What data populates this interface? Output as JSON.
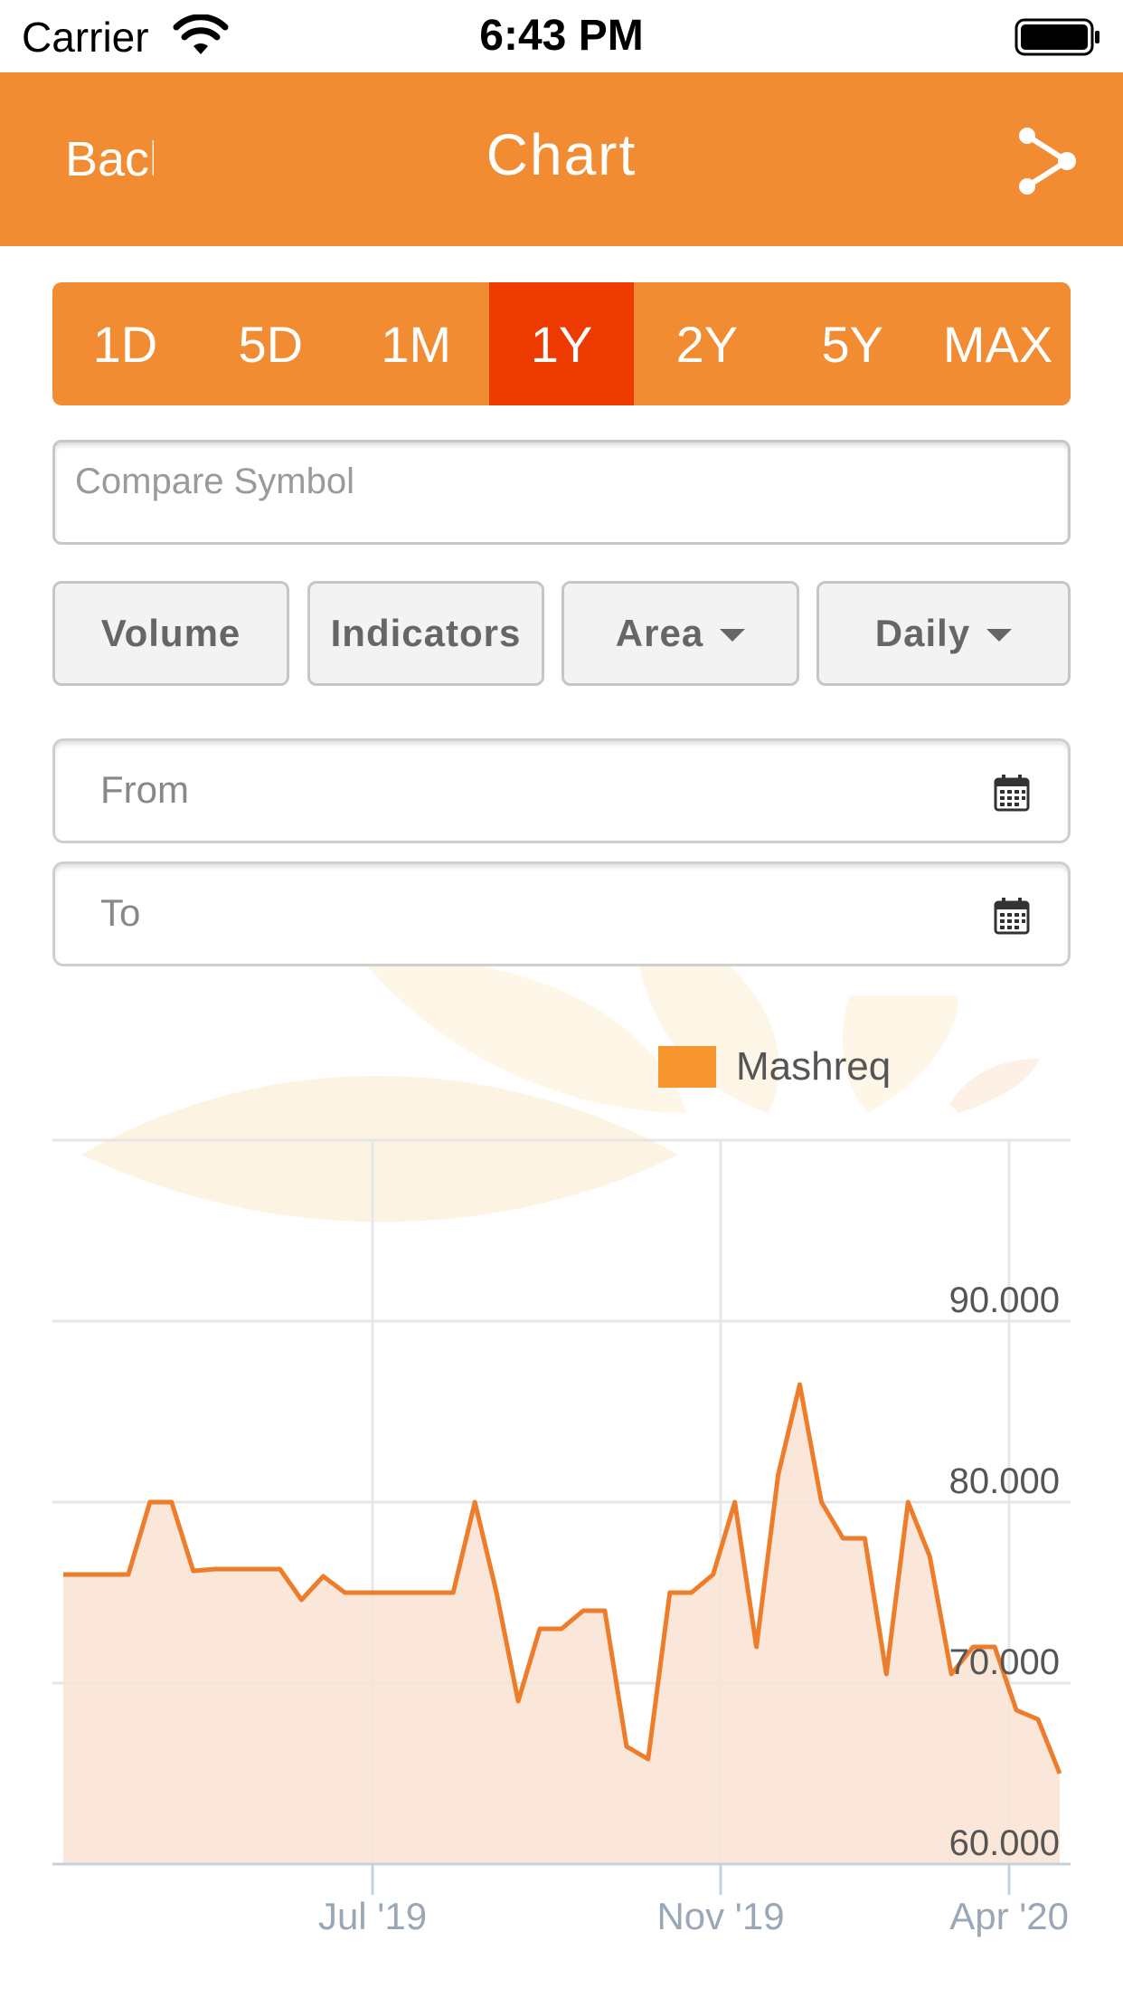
{
  "status_bar": {
    "carrier": "Carrier",
    "time": "6:43 PM"
  },
  "nav": {
    "back_label": "Back",
    "title": "Chart",
    "share_icon": "share-icon"
  },
  "range_tabs": [
    {
      "label": "1D"
    },
    {
      "label": "5D"
    },
    {
      "label": "1M"
    },
    {
      "label": "1Y",
      "active": true
    },
    {
      "label": "2Y"
    },
    {
      "label": "5Y"
    },
    {
      "label": "MAX"
    }
  ],
  "compare": {
    "placeholder": "Compare Symbol"
  },
  "options": {
    "volume": "Volume",
    "indicators": "Indicators",
    "chart_type": "Area",
    "interval": "Daily"
  },
  "dates": {
    "from": "From",
    "to": "To"
  },
  "colors": {
    "brand": "#f28c32",
    "active_tab": "#ec3a00",
    "series_line": "#ee7d2b",
    "series_fill": "#f9e3d4"
  },
  "chart_data": {
    "type": "area",
    "legend_position": "top-right",
    "grid": true,
    "series": [
      {
        "name": "Mashreq",
        "values": [
          76.0,
          76.0,
          76.0,
          76.0,
          80.0,
          80.0,
          76.2,
          76.3,
          76.3,
          76.3,
          76.3,
          74.6,
          75.9,
          75.0,
          75.0,
          75.0,
          75.0,
          75.0,
          75.0,
          80.0,
          75.0,
          69.0,
          73.0,
          73.0,
          74.0,
          74.0,
          66.5,
          65.8,
          75.0,
          75.0,
          76.0,
          80.0,
          72.0,
          81.5,
          86.5,
          80.0,
          78.0,
          78.0,
          70.5,
          80.0,
          77.0,
          70.5,
          72.0,
          72.0,
          68.5,
          68.0,
          65.0
        ]
      }
    ],
    "x_ticks": [
      "Jul '19",
      "Nov '19",
      "Apr '20"
    ],
    "y_ticks": [
      "60.000",
      "70.000",
      "80.000",
      "90.000"
    ],
    "ylim": [
      60,
      100
    ]
  }
}
